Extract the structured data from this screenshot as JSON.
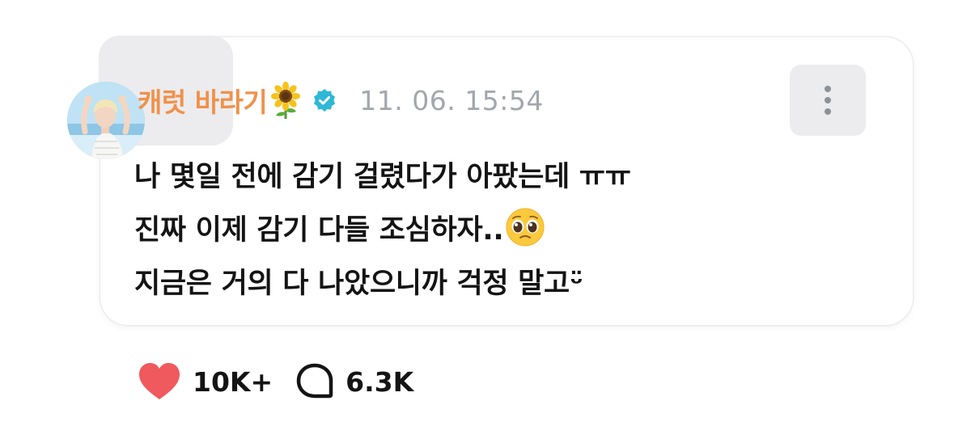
{
  "post": {
    "author": {
      "name": "캐럿 바라기",
      "name_emoji": "sunflower-emoji",
      "verified_icon": "verified-check-icon",
      "verified_color": "#2fb8d6",
      "name_color": "#f0914a"
    },
    "timestamp": "11. 06. 15:54",
    "body": {
      "line1": "나 몇일 전에 감기 걸렸다가 아팠는데 ㅠㅠ",
      "line2": "진짜 이제 감기 다들 조심하자..",
      "line2_emoji": "pleading-face-emoji",
      "line3": "지금은 거의 다 나았으니까 걱정 말고ᵕ̈"
    },
    "more_icon": "more-vertical-icon"
  },
  "reactions": {
    "like_icon": "heart-icon",
    "like_color": "#f0595e",
    "like_count": "10K+",
    "comment_icon": "comment-bubble-icon",
    "comment_count": "6.3K"
  }
}
